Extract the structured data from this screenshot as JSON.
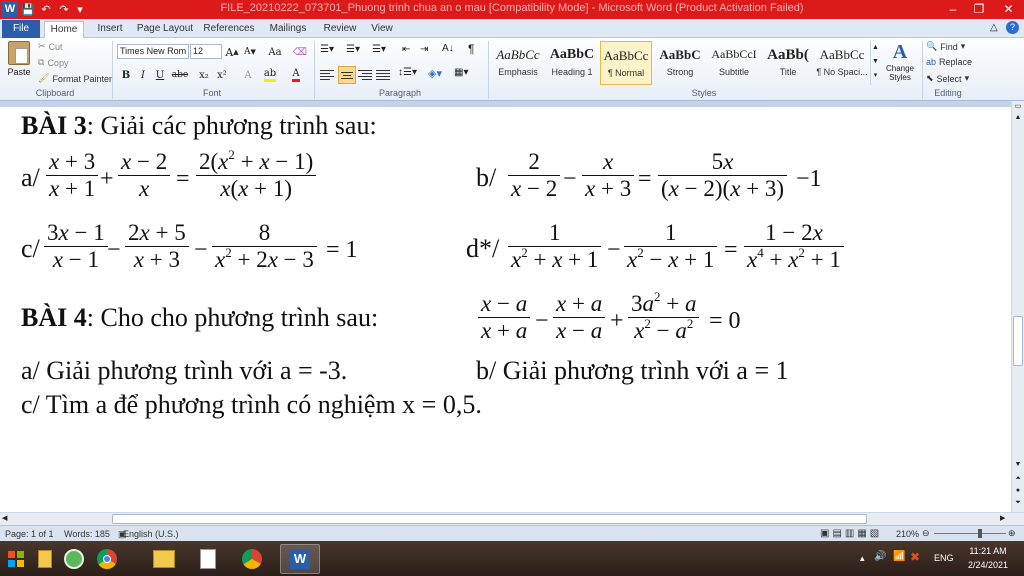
{
  "window": {
    "title": "FILE_20210222_073701_Phuong trinh chua an o mau [Compatibility Mode] - Microsoft Word (Product Activation Failed)",
    "titlebar_color": "#dc1a1a",
    "minimize": "–",
    "restore": "❐",
    "close": "✕"
  },
  "tabs": [
    {
      "label": "File"
    },
    {
      "label": "Home"
    },
    {
      "label": "Insert"
    },
    {
      "label": "Page Layout"
    },
    {
      "label": "References"
    },
    {
      "label": "Mailings"
    },
    {
      "label": "Review"
    },
    {
      "label": "View"
    }
  ],
  "ribbon": {
    "clipboard": {
      "paste": "Paste",
      "cut": "Cut",
      "copy": "Copy",
      "format_painter": "Format Painter",
      "label": "Clipboard"
    },
    "font": {
      "name": "Times New Rom",
      "size": "12",
      "label": "Font",
      "grow": "A",
      "shrink": "A",
      "case": "Aa",
      "bold": "B",
      "italic": "I",
      "underline": "U",
      "strike": "abe",
      "subscript": "x₂",
      "superscript": "x²"
    },
    "paragraph": {
      "label": "Paragraph",
      "pilcrow": "¶"
    },
    "styles": {
      "label": "Styles",
      "items": [
        {
          "sample": "AaBbCc",
          "name": "Emphasis"
        },
        {
          "sample": "AaBbC",
          "name": "Heading 1"
        },
        {
          "sample": "AaBbCc",
          "name": "¶ Normal"
        },
        {
          "sample": "AaBbC",
          "name": "Strong"
        },
        {
          "sample": "AaBbCcI",
          "name": "Subtitle"
        },
        {
          "sample": "AaBb(",
          "name": "Title"
        },
        {
          "sample": "AaBbCc",
          "name": "¶ No Spaci..."
        }
      ],
      "change_styles": "Change Styles"
    },
    "editing": {
      "label": "Editing",
      "find": "Find",
      "replace": "Replace",
      "select": "Select"
    }
  },
  "document": {
    "bai3_heading": "BÀI 3",
    "bai3_text": ": Giải các phương trình sau:",
    "a_label": "a/",
    "b_label": "b/",
    "c_label": "c/",
    "d_label": "d*/",
    "bai4_heading": "BÀI 4",
    "bai4_text": ":  Cho cho phương trình sau:",
    "bai4_a": "a/ Giải phương trình với a = -3.",
    "bai4_b": "b/ Giải phương trình với  a = 1",
    "bai4_c": "c/ Tìm a để phương trình có nghiệm  x = 0,5."
  },
  "status": {
    "page": "Page: 1 of 1",
    "words": "Words: 185",
    "language": "English (U.S.)",
    "zoom": "210%"
  },
  "taskbar": {
    "lang": "ENG",
    "time": "11:21 AM",
    "date": "2/24/2021"
  }
}
